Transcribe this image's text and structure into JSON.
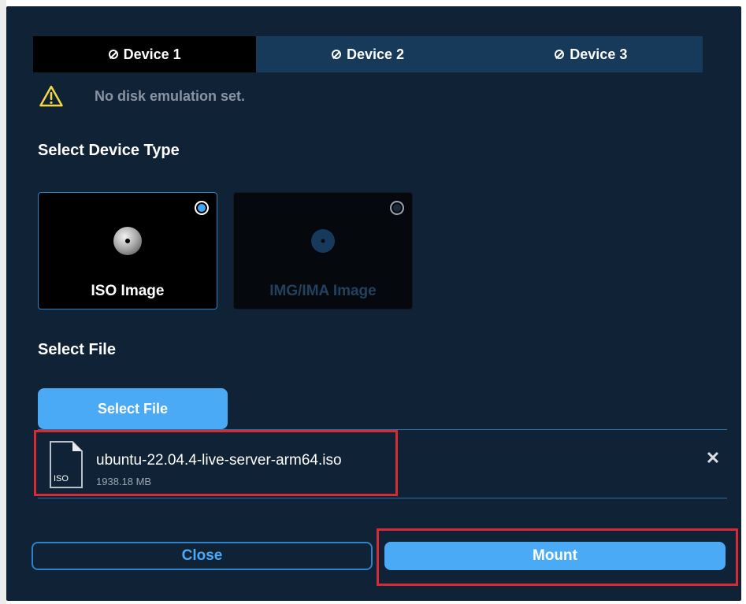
{
  "tabs": [
    {
      "label": "Device 1",
      "active": true
    },
    {
      "label": "Device 2",
      "active": false
    },
    {
      "label": "Device 3",
      "active": false
    }
  ],
  "warning": {
    "icon": "warning-icon",
    "text": "No disk emulation set."
  },
  "device_type": {
    "title": "Select Device Type",
    "options": [
      {
        "label": "ISO Image",
        "selected": true,
        "icon": "disc-icon"
      },
      {
        "label": "IMG/IMA Image",
        "selected": false,
        "icon": "disc-icon"
      }
    ]
  },
  "select_file": {
    "title": "Select File",
    "button_label": "Select File"
  },
  "file": {
    "name": "ubuntu-22.04.4-live-server-arm64.iso",
    "size": "1938.18 MB",
    "icon_label": "ISO",
    "remove_icon": "close-icon"
  },
  "actions": {
    "close_label": "Close",
    "mount_label": "Mount"
  },
  "colors": {
    "background": "#0f2236",
    "accent": "#4aaaf5",
    "highlight": "#d62a35",
    "warning": "#f5d742"
  }
}
